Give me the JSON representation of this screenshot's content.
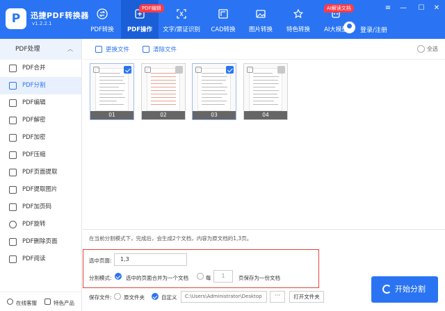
{
  "app": {
    "name": "迅捷PDF转换器",
    "version": "v1.2.2.1",
    "logo_letter": "P"
  },
  "nav": [
    {
      "label": "PDF转换",
      "icon": "convert-icon"
    },
    {
      "label": "PDF操作",
      "icon": "pdf-edit-icon",
      "active": true,
      "badge": "PDF编辑"
    },
    {
      "label": "文字/票证识别",
      "icon": "ocr-icon"
    },
    {
      "label": "CAD转换",
      "icon": "cad-icon"
    },
    {
      "label": "图片转换",
      "icon": "image-icon"
    },
    {
      "label": "特色转换",
      "icon": "special-icon"
    },
    {
      "label": "AI大模型",
      "icon": "ai-icon",
      "badge": "AI解读文档"
    }
  ],
  "user": {
    "login": "登录/注册"
  },
  "window": {
    "menu": "≡",
    "minimize": "—",
    "maximize": "☐",
    "close": "✕"
  },
  "sidebar": {
    "header": "PDF处理",
    "items": [
      {
        "label": "PDF合并"
      },
      {
        "label": "PDF分割",
        "active": true
      },
      {
        "label": "PDF编辑"
      },
      {
        "label": "PDF解密"
      },
      {
        "label": "PDF加密"
      },
      {
        "label": "PDF压缩"
      },
      {
        "label": "PDF页面提取"
      },
      {
        "label": "PDF提取图片"
      },
      {
        "label": "PDF加页码"
      },
      {
        "label": "PDF旋转"
      },
      {
        "label": "PDF删除页面"
      },
      {
        "label": "PDF阅读"
      }
    ],
    "footer": {
      "service": "在线客服",
      "featured": "特色产品"
    }
  },
  "toolbar": {
    "replace": "更换文件",
    "clear": "清除文件",
    "select_all": "全选"
  },
  "thumbnails": [
    {
      "label": "01",
      "checked": true
    },
    {
      "label": "02",
      "checked": false
    },
    {
      "label": "03",
      "checked": true
    },
    {
      "label": "04",
      "checked": false
    }
  ],
  "split": {
    "info": "在当前分割模式下，完成后，会生成2个文档，内容为原文档的1,3页。",
    "selected_pages_label": "选中页面:",
    "selected_pages_value": "1,3",
    "mode_label": "分割模式:",
    "mode_option1": "选中的页面合并为一个文档",
    "mode_option2_prefix": "每",
    "mode_option2_value": "1",
    "mode_option2_suffix": "页保存为一份文档"
  },
  "save": {
    "label": "保存文件:",
    "option_source": "原文件夹",
    "option_custom": "自定义",
    "path": "C:\\Users\\Administrator\\Desktop",
    "browse": "···",
    "open_folder": "打开文件夹"
  },
  "start_button": "开始分割",
  "colors": {
    "primary": "#2a74f3",
    "active_nav": "#1a5fd8",
    "badge": "#ff3b48",
    "highlight_box": "#e0453a"
  }
}
